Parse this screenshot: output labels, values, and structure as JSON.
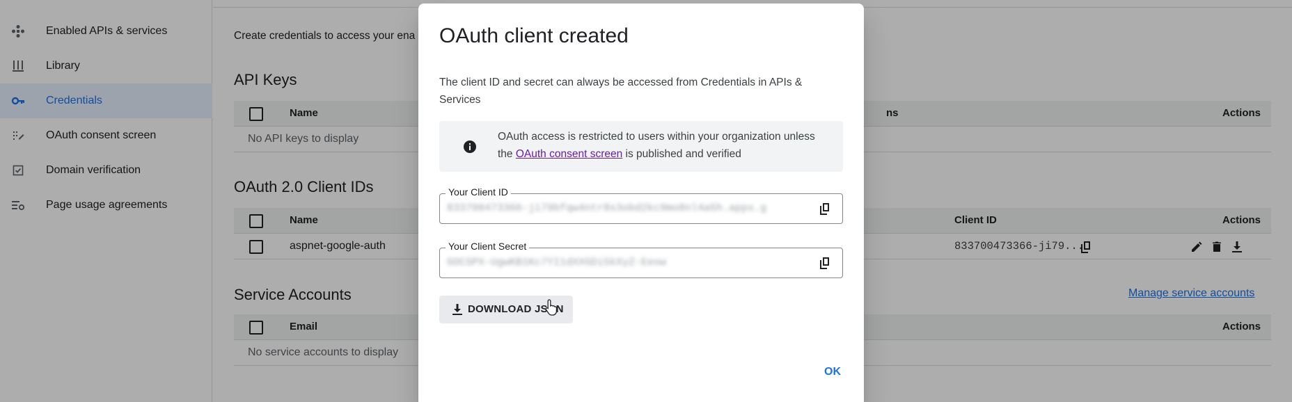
{
  "sidebar": {
    "items": [
      {
        "label": "Enabled APIs & services",
        "icon": "apis-icon"
      },
      {
        "label": "Library",
        "icon": "library-icon"
      },
      {
        "label": "Credentials",
        "icon": "key-icon",
        "active": true
      },
      {
        "label": "OAuth consent screen",
        "icon": "consent-icon"
      },
      {
        "label": "Domain verification",
        "icon": "checkbox-icon"
      },
      {
        "label": "Page usage agreements",
        "icon": "settings-list-icon"
      }
    ]
  },
  "main": {
    "intro": "Create credentials to access your ena",
    "api_keys": {
      "title": "API Keys",
      "header_name": "Name",
      "header_restrictions_partial": "ns",
      "header_actions": "Actions",
      "empty": "No API keys to display"
    },
    "oauth": {
      "title": "OAuth 2.0 Client IDs",
      "header_name": "Name",
      "header_client_id": "Client ID",
      "header_actions": "Actions",
      "row_name": "aspnet-google-auth",
      "row_client_id": "833700473366-ji79..."
    },
    "service_accounts": {
      "title": "Service Accounts",
      "manage_link": "Manage service accounts",
      "header_email": "Email",
      "header_actions": "Actions",
      "empty": "No service accounts to display"
    }
  },
  "dialog": {
    "title": "OAuth client created",
    "description": "The client ID and secret can always be accessed from Credentials in APIs & Services",
    "info_before": "OAuth access is restricted to users within your organization unless the ",
    "info_link": "OAuth consent screen",
    "info_after": " is published and verified",
    "client_id_label": "Your Client ID",
    "client_id_value": "833700473366-ji79bfqw4ntr8s3obd2kc9mo8nl4a5h.apps.g",
    "client_secret_label": "Your Client Secret",
    "client_secret_value": "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",
    "download_label": "DOWNLOAD JSON",
    "ok_label": "OK"
  },
  "colors": {
    "accent": "#1a73e8",
    "link_visited": "#681da8",
    "active_bg": "#e8f0fe"
  }
}
